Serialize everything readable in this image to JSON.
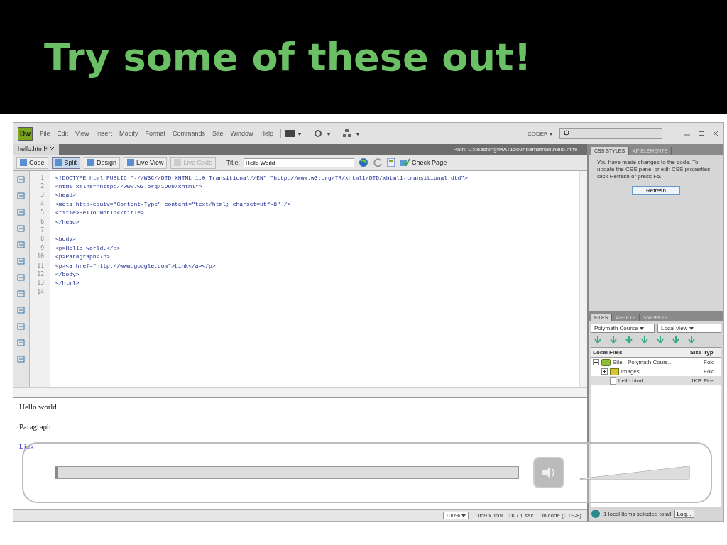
{
  "slide": {
    "title": "Try some of these out!"
  },
  "app": {
    "logo": "Dw",
    "menu": [
      "File",
      "Edit",
      "View",
      "Insert",
      "Modify",
      "Format",
      "Commands",
      "Site",
      "Window",
      "Help"
    ],
    "workspace": "CODER ▾",
    "document_tab": "hello.html*",
    "path": "Path: C:\\teaching\\MAT150\\mbarnathan\\hello.html",
    "view_buttons": [
      {
        "label": "Code",
        "selected": false,
        "disabled": false
      },
      {
        "label": "Split",
        "selected": true,
        "disabled": false
      },
      {
        "label": "Design",
        "selected": false,
        "disabled": false
      },
      {
        "label": "Live View",
        "selected": false,
        "disabled": false
      },
      {
        "label": "Live Code",
        "selected": false,
        "disabled": true
      }
    ],
    "title_field": {
      "label": "Title:",
      "value": "Hello World"
    },
    "check_page": "Check Page",
    "code_lines": [
      {
        "number": "1",
        "text": "<!DOCTYPE html PUBLIC \"-//W3C//DTD XHTML 1.0 Transitional//EN\" \"http://www.w3.org/TR/xhtml1/DTD/xhtml1-transitional.dtd\">"
      },
      {
        "number": "2",
        "text": "<html xmlns=\"http://www.w3.org/1999/xhtml\">"
      },
      {
        "number": "3",
        "text": "<head>"
      },
      {
        "number": "4",
        "text": "<meta http-equiv=\"Content-Type\" content=\"text/html; charset=utf-8\" />"
      },
      {
        "number": "5",
        "text": "<title>Hello World</title>"
      },
      {
        "number": "6",
        "text": "</head>"
      },
      {
        "number": "7"
      },
      {
        "number": "8",
        "text": "<body>"
      },
      {
        "number": "9",
        "text": "<p>Hello world.</p>"
      },
      {
        "number": "10",
        "text": "<p>Paragraph</p>"
      },
      {
        "number": "11",
        "text": "<p><a href=\"http://www.google.com\">Link</a></p>"
      },
      {
        "number": "12",
        "text": "</body>"
      },
      {
        "number": "13",
        "text": "</html>"
      },
      {
        "number": "14"
      }
    ],
    "design_view": [
      {
        "kind": "text",
        "text": "Hello world."
      },
      {
        "kind": "text",
        "text": "Paragraph"
      },
      {
        "kind": "link",
        "text": "Link"
      }
    ],
    "status_bar": {
      "zoom": "100%",
      "size": "1059 x 159",
      "download": "1K / 1 sec",
      "encoding": "Unicode (UTF-8)"
    },
    "css_panel": {
      "tabs": [
        {
          "label": "CSS STYLES",
          "selected": true
        },
        {
          "label": "AP ELEMENTS",
          "selected": false
        }
      ],
      "message": "You have made changes to the code. To update the CSS panel or edit CSS properties, click Refresh or press F5.",
      "button": "Refresh"
    },
    "files_panel": {
      "tabs": [
        {
          "label": "FILES",
          "selected": true
        },
        {
          "label": "ASSETS",
          "selected": false
        },
        {
          "label": "SNIPPETS",
          "selected": false
        }
      ],
      "site": "Polymath Course",
      "view": "Local view",
      "columns": [
        "Local Files",
        "Size",
        "Typ"
      ],
      "tree": [
        {
          "name": "Site - Polymath Cours...",
          "type": "Fold",
          "kind": "site",
          "expanded": true,
          "selected": false,
          "children": [
            {
              "name": "images",
              "type": "Fold",
              "kind": "folder",
              "expanded": false,
              "selected": false
            },
            {
              "name": "hello.html",
              "size": "1KB",
              "type": "Fire",
              "kind": "file",
              "selected": true
            }
          ]
        }
      ],
      "status": "1 local items selected totall",
      "log_button": "Log..."
    }
  },
  "player": {
    "progress": {
      "level": 0.005
    },
    "volume": {
      "level": 1
    }
  }
}
